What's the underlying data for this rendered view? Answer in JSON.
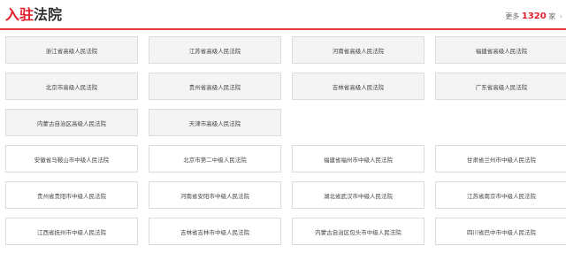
{
  "header": {
    "title_accent": "入驻",
    "title_rest": "法院",
    "more_prefix": "更多",
    "more_count": "1320",
    "more_suffix": "家",
    "more_arrow": "›"
  },
  "high_courts": [
    "浙江省高级人民法院",
    "江苏省高级人民法院",
    "河南省高级人民法院",
    "福建省高级人民法院",
    "北京市高级人民法院",
    "贵州省高级人民法院",
    "吉林省高级人民法院",
    "广东省高级人民法院",
    "内蒙古自治区高级人民法院",
    "天津市高级人民法院"
  ],
  "mid_courts": [
    "安徽省马鞍山市中级人民法院",
    "北京市第二中级人民法院",
    "福建省福州市中级人民法院",
    "甘肃省兰州市中级人民法院",
    "贵州省贵阳市中级人民法院",
    "河南省安阳市中级人民法院",
    "湖北省武汉市中级人民法院",
    "江苏省南京市中级人民法院",
    "江西省抚州市中级人民法院",
    "吉林省吉林市中级人民法院",
    "内蒙古自治区包头市中级人民法院",
    "四川省巴中市中级人民法院"
  ]
}
